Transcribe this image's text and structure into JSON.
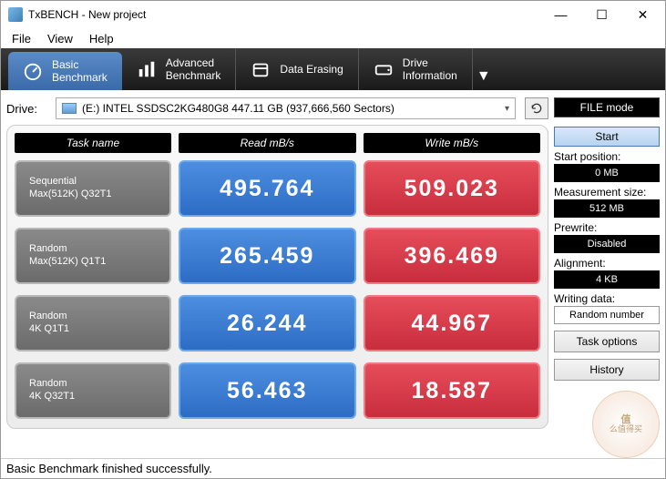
{
  "window": {
    "title": "TxBENCH - New project",
    "min": "—",
    "max": "☐",
    "close": "✕"
  },
  "menu": {
    "file": "File",
    "view": "View",
    "help": "Help"
  },
  "tabs": {
    "basic": "Basic\nBenchmark",
    "advanced": "Advanced\nBenchmark",
    "erasing": "Data Erasing",
    "drive": "Drive\nInformation"
  },
  "drive": {
    "label": "Drive:",
    "selected": "(E:) INTEL SSDSC2KG480G8  447.11 GB (937,666,560 Sectors)"
  },
  "filemode": "FILE mode",
  "headers": {
    "task": "Task name",
    "read": "Read mB/s",
    "write": "Write mB/s"
  },
  "rows": [
    {
      "name1": "Sequential",
      "name2": "Max(512K) Q32T1",
      "read": "495.764",
      "write": "509.023"
    },
    {
      "name1": "Random",
      "name2": "Max(512K) Q1T1",
      "read": "265.459",
      "write": "396.469"
    },
    {
      "name1": "Random",
      "name2": "4K Q1T1",
      "read": "26.244",
      "write": "44.967"
    },
    {
      "name1": "Random",
      "name2": "4K Q32T1",
      "read": "56.463",
      "write": "18.587"
    }
  ],
  "side": {
    "start": "Start",
    "startpos_l": "Start position:",
    "startpos_v": "0 MB",
    "meassize_l": "Measurement size:",
    "meassize_v": "512 MB",
    "prewrite_l": "Prewrite:",
    "prewrite_v": "Disabled",
    "align_l": "Alignment:",
    "align_v": "4 KB",
    "wdata_l": "Writing data:",
    "wdata_v": "Random number",
    "taskopt": "Task options",
    "history": "History"
  },
  "status": "Basic Benchmark finished successfully.",
  "watermark": {
    "a": "值",
    "b": "么值得买"
  },
  "chart_data": {
    "type": "table",
    "title": "Basic Benchmark",
    "columns": [
      "Task name",
      "Read mB/s",
      "Write mB/s"
    ],
    "rows": [
      [
        "Sequential Max(512K) Q32T1",
        495.764,
        509.023
      ],
      [
        "Random Max(512K) Q1T1",
        265.459,
        396.469
      ],
      [
        "Random 4K Q1T1",
        26.244,
        44.967
      ],
      [
        "Random 4K Q32T1",
        56.463,
        18.587
      ]
    ]
  }
}
